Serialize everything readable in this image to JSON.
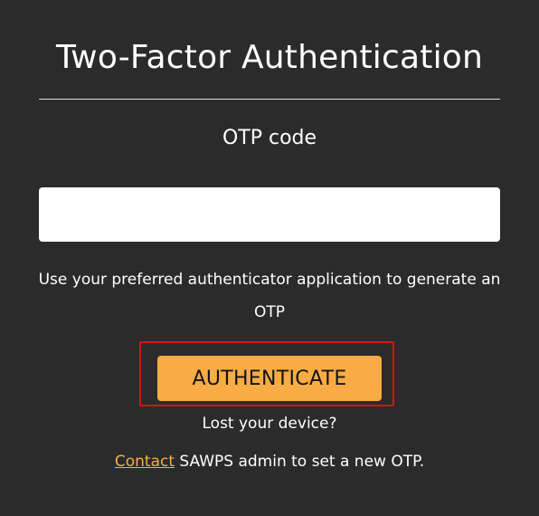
{
  "page": {
    "title": "Two-Factor Authentication"
  },
  "otp": {
    "label": "OTP code",
    "value": "",
    "placeholder": ""
  },
  "help": {
    "text": "Use your preferred authenticator application to generate an OTP"
  },
  "actions": {
    "authenticate_label": "AUTHENTICATE"
  },
  "recovery": {
    "lost_device_text": "Lost your device?",
    "contact_link_text": "Contact",
    "contact_rest_text": " SAWPS admin to set a new OTP."
  },
  "colors": {
    "background": "#2b2b2b",
    "accent": "#f9ac45",
    "highlight_border": "#d01616",
    "text": "#ffffff"
  }
}
